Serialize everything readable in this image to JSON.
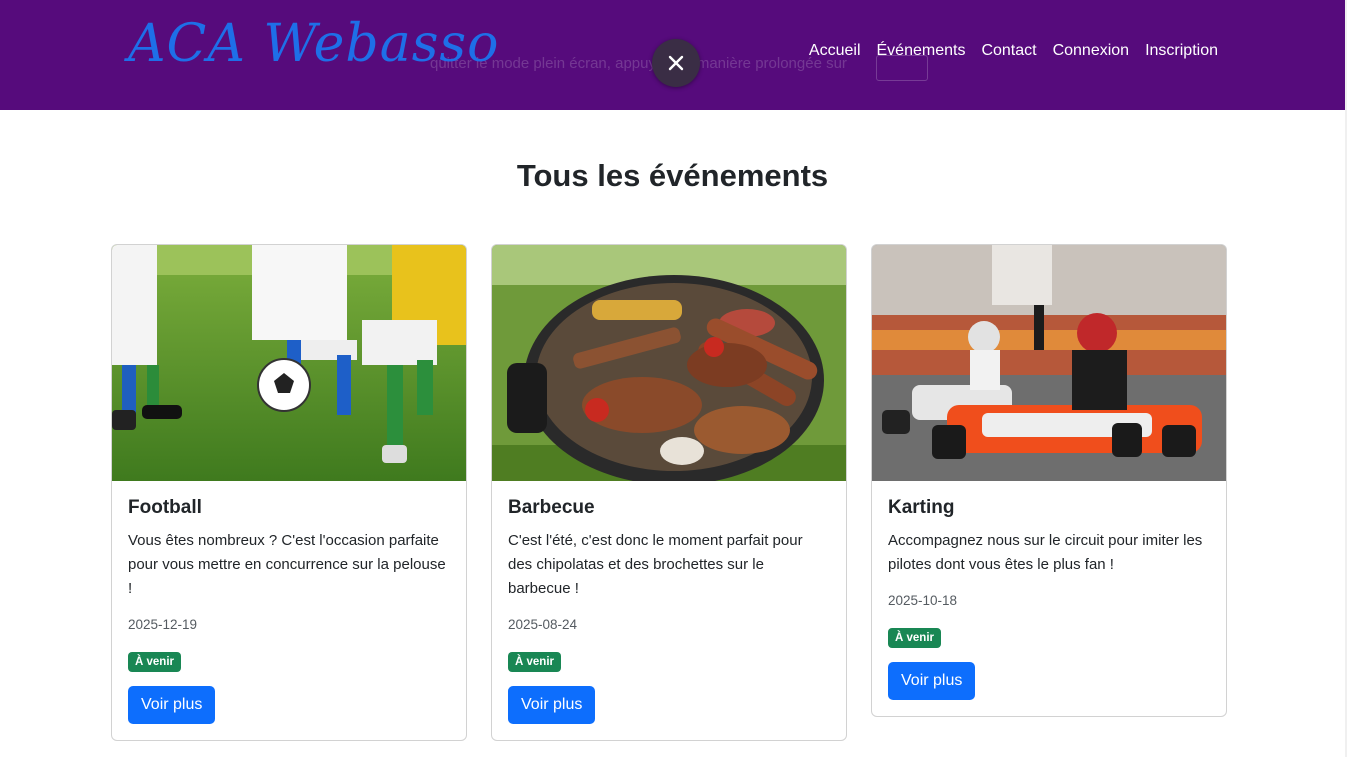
{
  "navbar": {
    "brand": "ACA Webasso",
    "fullscreen_notice": "quitter le mode plein écran, appuyez de manière prolongée sur",
    "links": [
      "Accueil",
      "Événements",
      "Contact",
      "Connexion",
      "Inscription"
    ]
  },
  "page": {
    "title": "Tous les événements"
  },
  "events": [
    {
      "title": "Football",
      "description": "Vous êtes nombreux ? C'est l'occasion parfaite pour vous mettre en concurrence sur la pelouse !",
      "date": "2025-12-19",
      "badge": "À venir",
      "button": "Voir plus",
      "image": "football-photo"
    },
    {
      "title": "Barbecue",
      "description": "C'est l'été, c'est donc le moment parfait pour des chipolatas et des brochettes sur le barbecue !",
      "date": "2025-08-24",
      "badge": "À venir",
      "button": "Voir plus",
      "image": "barbecue-photo"
    },
    {
      "title": "Karting",
      "description": "Accompagnez nous sur le circuit pour imiter les pilotes dont vous êtes le plus fan !",
      "date": "2025-10-18",
      "badge": "À venir",
      "button": "Voir plus",
      "image": "karting-photo"
    }
  ],
  "colors": {
    "navbar_bg": "#560b7c",
    "brand": "#1e6fe8",
    "badge": "#198754",
    "button": "#0d6efd"
  }
}
